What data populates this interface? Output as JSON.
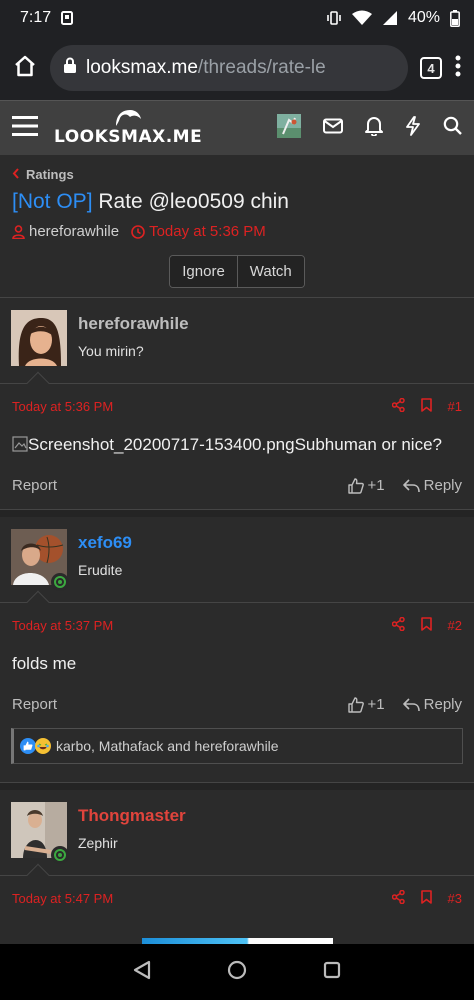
{
  "status": {
    "time": "7:17",
    "battery": "40%"
  },
  "browser": {
    "url_host": "looksmax.me",
    "url_path": "/threads/rate-le",
    "tab_count": "4"
  },
  "site": {
    "logo": "LOOKSMAX.ME"
  },
  "breadcrumb": "Ratings",
  "thread": {
    "prefix": "[Not OP]",
    "title": "Rate @leo0509 chin",
    "author": "hereforawhile",
    "date": "Today at 5:36 PM",
    "ignore_label": "Ignore",
    "watch_label": "Watch"
  },
  "posts": [
    {
      "username": "hereforawhile",
      "user_title": "You mirin?",
      "username_color": "#bdbdbd",
      "date": "Today at 5:36 PM",
      "number": "#1",
      "body": "Screenshot_20200717-153400.pngSubhuman or nice?",
      "report_label": "Report",
      "like_count": "+1",
      "reply_label": "Reply"
    },
    {
      "username": "xefo69",
      "user_title": "Erudite",
      "username_color": "#2d8ef5",
      "date": "Today at 5:37 PM",
      "number": "#2",
      "body": "folds me",
      "report_label": "Report",
      "like_count": "+1",
      "reply_label": "Reply",
      "reactions_text": "karbo, Mathafack and hereforawhile"
    },
    {
      "username": "Thongmaster",
      "user_title": "Zephir",
      "username_color": "#e0443c",
      "date": "Today at 5:47 PM",
      "number": "#3"
    }
  ],
  "colors": {
    "accent_red": "#dd2222",
    "link_blue": "#2d8ef5"
  }
}
